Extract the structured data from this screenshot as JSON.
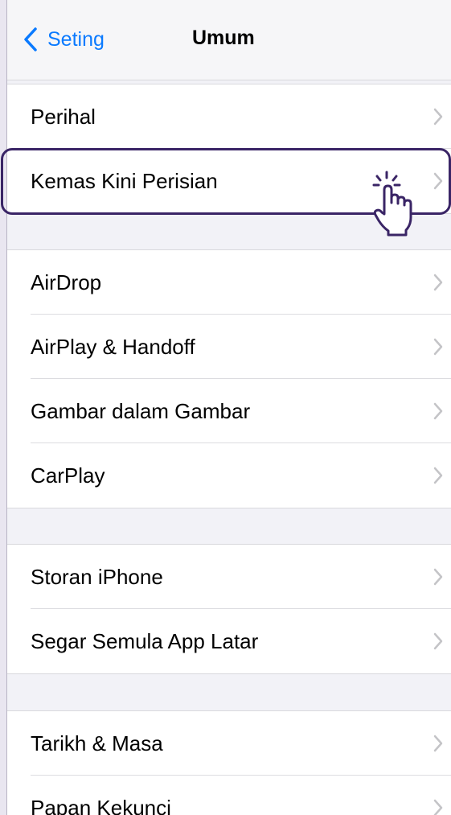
{
  "nav": {
    "back_label": "Seting",
    "title": "Umum"
  },
  "groups": [
    {
      "items": [
        {
          "label": "Perihal"
        },
        {
          "label": "Kemas Kini Perisian"
        }
      ]
    },
    {
      "items": [
        {
          "label": "AirDrop"
        },
        {
          "label": "AirPlay & Handoff"
        },
        {
          "label": "Gambar dalam Gambar"
        },
        {
          "label": "CarPlay"
        }
      ]
    },
    {
      "items": [
        {
          "label": "Storan iPhone"
        },
        {
          "label": "Segar Semula App Latar"
        }
      ]
    },
    {
      "items": [
        {
          "label": "Tarikh & Masa"
        },
        {
          "label": "Papan Kekunci"
        }
      ]
    }
  ],
  "highlighted_item": "Kemas Kini Perisian",
  "colors": {
    "accent": "#0a7aff",
    "highlight": "#3a2566",
    "background": "#f2f2f7"
  },
  "icons": {
    "back": "chevron-left-icon",
    "row": "chevron-right-icon",
    "pointer": "tap-hand-icon"
  }
}
